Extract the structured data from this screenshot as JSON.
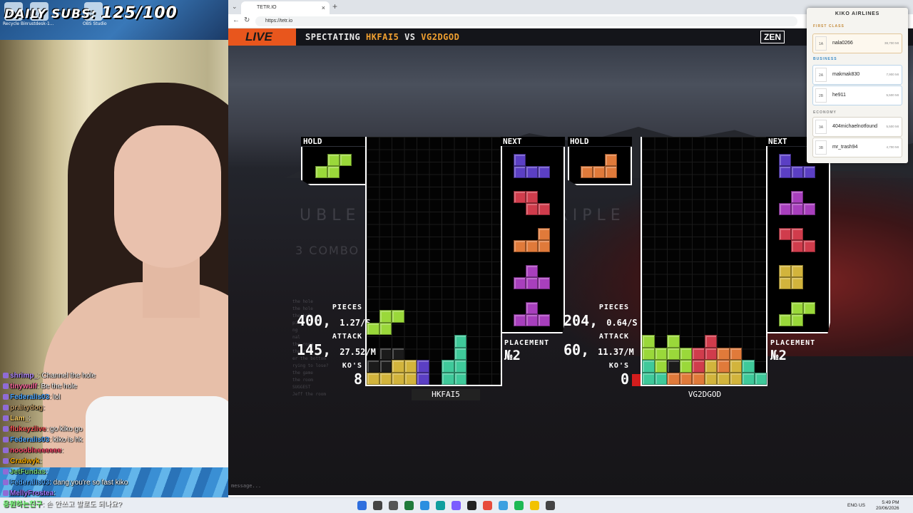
{
  "overlay": {
    "daily_subs_label": "DAILY SUBS:",
    "daily_subs_value": "125/100"
  },
  "desktop": {
    "icons": [
      "Recycle Bin",
      "rustdesk-1...",
      "OBS Studio"
    ]
  },
  "browser": {
    "tab_title": "TETR.IO",
    "url": "https://tetr.io",
    "new_tab": "+",
    "close": "×"
  },
  "game": {
    "live_label": "LIVE",
    "spectating_label": "SPECTATING",
    "player1": "HKFAI5",
    "vs_label": "VS",
    "player2": "VG2DGOD",
    "zen_label": "ZEN",
    "faded_clear_left": "UBLE",
    "faded_combo_left": "3 COMBO",
    "faded_clear_right": "TRIPLE",
    "message_placeholder": "message...",
    "faded_chat": [
      "the hole",
      "the hole",
      "the hole",
      "ping",
      "ng",
      "nal",
      "the room",
      "the room",
      "er the bottom",
      "rying to lose?",
      "the game",
      "the room",
      "SUGGEST",
      "Jeff the room"
    ],
    "hold_label": "HOLD",
    "next_label": "NEXT",
    "pieces_label": "PIECES",
    "attack_label": "ATTACK",
    "kos_label": "KO'S",
    "placement_label": "PLACEMENT",
    "left": {
      "pieces": "400,",
      "pps": "1.27/S",
      "attack": "145,",
      "apm": "27.52/M",
      "kos": "8",
      "placement": "№2",
      "name": "HKFAI5"
    },
    "right": {
      "pieces": "204,",
      "pps": "0.64/S",
      "attack": "60,",
      "apm": "11.37/M",
      "kos": "0",
      "placement": "№2",
      "name": "VG2DGOD"
    },
    "piece_colors": {
      "S": "#9ad83a",
      "T": "#a83fbd",
      "Z": "#d03c4c",
      "L": "#e07a3a",
      "J": "#5b3fc4",
      "O": "#d2b43c",
      "I": "#3fc99a",
      "garbage": "#7a7a7a"
    }
  },
  "chat": [
    {
      "user": "shrimp_",
      "color": "#b48cff",
      "msg": ": Channel the hole"
    },
    {
      "user": "tinywulf",
      "color": "#ff6aa0",
      "msg": ": Be the hole"
    },
    {
      "user": "Federalis03",
      "color": "#4fa8ff",
      "msg": ": lol"
    },
    {
      "user": "prairydog",
      "color": "#c9a36a",
      "msg": ":"
    },
    {
      "user": "Lam_",
      "color": "#ffd166",
      "msg": ":"
    },
    {
      "user": "flukeyzlive",
      "color": "#ff5a5a",
      "msg": ": go kiko go"
    },
    {
      "user": "Federalis03",
      "color": "#4fa8ff",
      "msg": ": kiko is hk"
    },
    {
      "user": "nooobleeeeeee",
      "color": "#ff4d6d",
      "msg": ":"
    },
    {
      "user": "Cradwyk",
      "color": "#ffb000",
      "msg": ":"
    },
    {
      "user": "JetFundas",
      "color": "#7ad67a",
      "msg": ":"
    },
    {
      "user": "Federalis03",
      "color": "#4fa8ff",
      "msg": ": dang you're so fast kiko"
    },
    {
      "user": "MellyFrostea",
      "color": "#a879ff",
      "msg": ":"
    }
  ],
  "ticker": {
    "user": "응원하는친구",
    "msg": ": 손 안쓰고 발로도 되나요?"
  },
  "airline": {
    "title": "KIKO AIRLINES",
    "sections": {
      "first": "FIRST CLASS",
      "business": "BUSINESS",
      "economy": "ECONOMY"
    },
    "rows": [
      {
        "seat": "1A",
        "name": "nala0266",
        "score": "38,700 MI"
      },
      {
        "seat": "2A",
        "name": "makmak830",
        "score": "7,900 MI"
      },
      {
        "seat": "2B",
        "name": "he911",
        "score": "5,500 MI"
      },
      {
        "seat": "3A",
        "name": "404michaelnotfound",
        "score": "5,500 MI"
      },
      {
        "seat": "3B",
        "name": "mr_trash94",
        "score": "4,700 MI"
      }
    ]
  },
  "taskbar": {
    "time": "5:49 PM",
    "date": "20/06/2026",
    "lang": "ENG US"
  }
}
